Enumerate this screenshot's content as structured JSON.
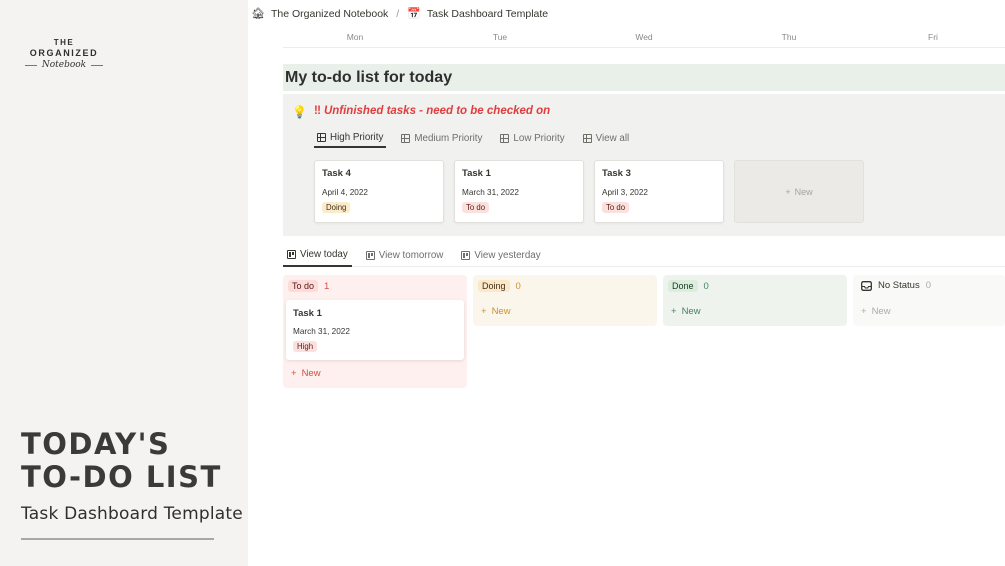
{
  "promo": {
    "logo_line1": "THE",
    "logo_line2": "ORGANIZED",
    "logo_script": "Notebook",
    "headline_1": "TODAY'S",
    "headline_2": "TO-DO LIST",
    "subtitle": "Task Dashboard Template"
  },
  "breadcrumb": {
    "items": [
      {
        "icon": "🏚",
        "label": "The Organized Notebook"
      },
      {
        "icon": "📅",
        "label": "Task Dashboard Template"
      }
    ],
    "separator": "/"
  },
  "week": [
    "Mon",
    "Tue",
    "Wed",
    "Thu",
    "Fri"
  ],
  "page_title": "My to-do list for today",
  "callout": {
    "icon": "💡",
    "marks": "‼",
    "text": "Unfinished tasks - need to be checked on",
    "tabs": [
      "High Priority",
      "Medium Priority",
      "Low Priority",
      "View all"
    ],
    "cards": [
      {
        "title": "Task 4",
        "date": "April 4, 2022",
        "status": "Doing"
      },
      {
        "title": "Task 1",
        "date": "March 31, 2022",
        "status": "To do"
      },
      {
        "title": "Task 3",
        "date": "April 3, 2022",
        "status": "To do"
      }
    ],
    "new_label": "New"
  },
  "board": {
    "tabs": [
      "View today",
      "View tomorrow",
      "View yesterday"
    ],
    "columns": [
      {
        "name": "To do",
        "count": "1",
        "new_label": "New",
        "card": {
          "title": "Task 1",
          "date": "March 31, 2022",
          "priority": "High"
        }
      },
      {
        "name": "Doing",
        "count": "0",
        "new_label": "New"
      },
      {
        "name": "Done",
        "count": "0",
        "new_label": "New"
      },
      {
        "name": "No Status",
        "count": "0",
        "new_label": "New"
      }
    ]
  },
  "colors": {
    "todo_bg": "#fdf0ee",
    "doing_bg": "#fbf6ec",
    "done_bg": "#eef3ed",
    "nostatus_bg": "#f9f9f8",
    "todo_accent": "#d44c47",
    "doing_accent": "#cb912f",
    "done_accent": "#448361",
    "muted": "#acaba9"
  }
}
